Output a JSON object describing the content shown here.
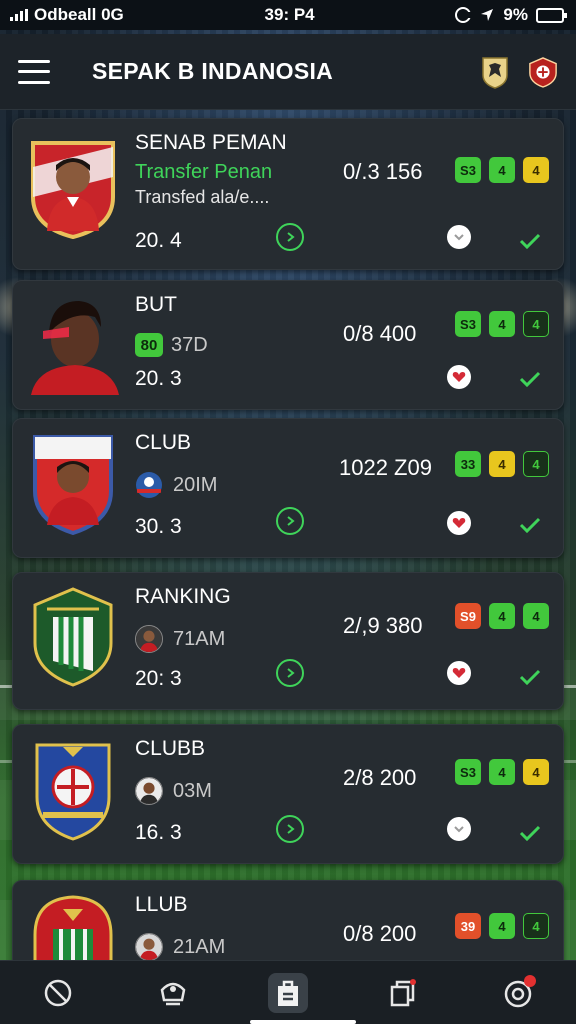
{
  "status_bar": {
    "carrier": "Odbeall 0G",
    "time": "39: P4",
    "battery": "9%"
  },
  "header": {
    "title": "SEPAK B INDANOSIA",
    "menu_icon": "hamburger-menu-icon",
    "badge_icons": [
      "league-badge-icon",
      "club-badge-icon"
    ]
  },
  "cards": [
    {
      "name": "SENAB PEMAN",
      "sub1": "Transfer Penan",
      "sub2": "Transfed ala/e....",
      "value": "20. 4",
      "stat": "0/.3  156",
      "badges": [
        {
          "label": "S3",
          "color": "green"
        },
        {
          "label": "4",
          "color": "green"
        },
        {
          "label": "4",
          "color": "yellow"
        }
      ],
      "heart_state": "empty"
    },
    {
      "name": "BUT",
      "chip": "80",
      "meta": "37D",
      "value": "20. 3",
      "stat": "0/8  400",
      "badges": [
        {
          "label": "S3",
          "color": "green"
        },
        {
          "label": "4",
          "color": "green"
        },
        {
          "label": "4",
          "color": "dark"
        }
      ],
      "heart_state": "liked"
    },
    {
      "name": "CLUB",
      "meta": "20IM",
      "value": "30. 3",
      "stat": "1022  Z09",
      "badges": [
        {
          "label": "33",
          "color": "green"
        },
        {
          "label": "4",
          "color": "yellow"
        },
        {
          "label": "4",
          "color": "dark"
        }
      ],
      "heart_state": "liked"
    },
    {
      "name": "RANKING",
      "meta": "71AM",
      "value": "20: 3",
      "stat": "2/,9  380",
      "badges": [
        {
          "label": "S9",
          "color": "red"
        },
        {
          "label": "4",
          "color": "green"
        },
        {
          "label": "4",
          "color": "green"
        }
      ],
      "heart_state": "liked"
    },
    {
      "name": "CLUBB",
      "meta": "03M",
      "value": "16. 3",
      "stat": "2/8  200",
      "badges": [
        {
          "label": "S3",
          "color": "green"
        },
        {
          "label": "4",
          "color": "green"
        },
        {
          "label": "4",
          "color": "yellow"
        }
      ],
      "heart_state": "empty"
    },
    {
      "name": "LLUB",
      "meta": "21AM",
      "value": "",
      "stat": "0/8  200",
      "badges": [
        {
          "label": "39",
          "color": "red"
        },
        {
          "label": "4",
          "color": "green"
        },
        {
          "label": "4",
          "color": "dark"
        }
      ],
      "heart_state": "none"
    }
  ],
  "bottom_nav": {
    "items": [
      "ball-icon",
      "trophy-icon",
      "lineup-icon",
      "cards-icon",
      "profile-icon"
    ],
    "active_index": 2
  },
  "colors": {
    "accent_green": "#42c83c",
    "card_bg": "#262c31",
    "header_bg": "#1d2329"
  }
}
